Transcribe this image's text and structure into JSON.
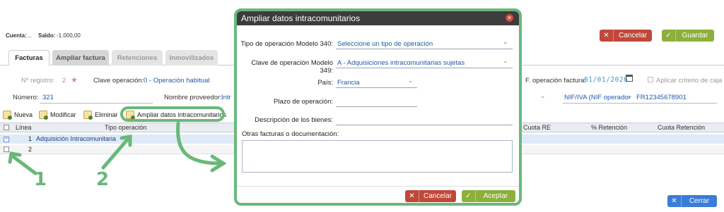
{
  "header": {
    "cuenta_label": "Cuenta:",
    "cuenta_value": "...",
    "saldo_label": "Saldo:",
    "saldo_value": "-1.000,00",
    "cancel_label": "Cancelar",
    "save_label": "Guardar"
  },
  "tabs": [
    "Facturas",
    "Ampliar factura",
    "Retenciones",
    "Inmovilizados"
  ],
  "form": {
    "registro_label": "Nº registro:",
    "registro_value": "2",
    "clave_label": "Clave operación:",
    "clave_value": "0 - Operación habitual",
    "fecha_label": "F. operación factura:",
    "fecha_value": "01/01/2026",
    "criterio_label": "Aplicar criterio de caja",
    "numero_label": "Número:",
    "numero_value": "321",
    "proveedor_label": "Nombre proveedor:",
    "proveedor_value": "Intr",
    "nif_label": "NIF/IVA (NIF operador",
    "nif_value": "FR12345678901"
  },
  "toolbar": {
    "nueva": "Nueva",
    "modificar": "Modificar",
    "eliminar": "Eliminar",
    "ampliar": "Ampliar datos intracomunitarios"
  },
  "table": {
    "headers": [
      "Línea",
      "Tipo operación",
      "Cuota RE",
      "% Retención",
      "Cuota Retención"
    ],
    "rows": [
      {
        "linea": "1",
        "tipo": "Adquisición Intracomunitaria"
      },
      {
        "linea": "2",
        "tipo": ""
      }
    ]
  },
  "footer": {
    "close_label": "Cerrar"
  },
  "modal": {
    "title": "Ampliar datos intracomunitarios",
    "tipo340_label": "Tipo de operación Modelo 340:",
    "tipo340_value": "Seleccione un tipo de operación",
    "clave349_label": "Clave de operación Modelo 349:",
    "clave349_value": "A - Adquisiciones intracomunitarias sujetas",
    "pais_label": "País:",
    "pais_value": "Francia",
    "plazo_label": "Plazo de operación:",
    "plazo_value": "",
    "descripcion_label": "Descripción de los bienes:",
    "descripcion_value": "",
    "otras_label": "Otras facturas o documentación:",
    "otras_value": "",
    "cancel_label": "Cancelar",
    "accept_label": "Aceptar"
  },
  "annotations": {
    "marker1": "1",
    "marker2": "2"
  },
  "colors": {
    "accent": "#6ab87a",
    "cancel": "#c0483a",
    "save": "#8cb03a",
    "close": "#3b7dd8",
    "link": "#1e5aa8"
  }
}
